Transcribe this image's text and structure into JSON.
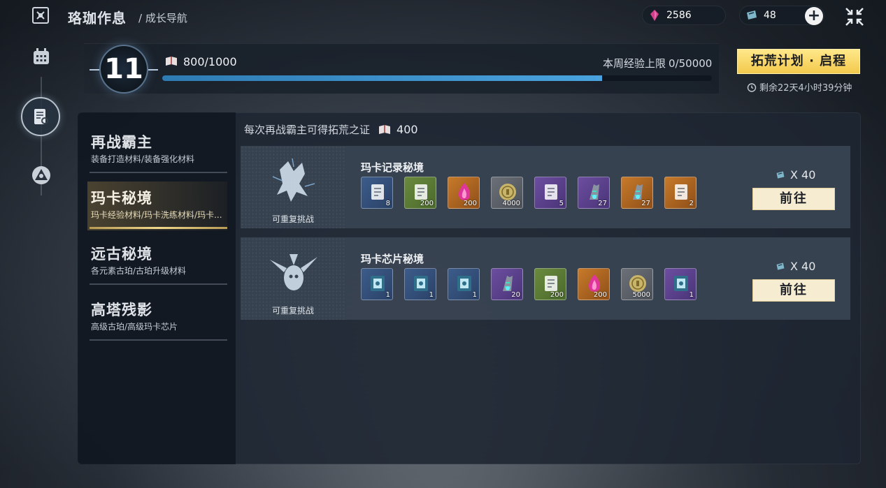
{
  "header": {
    "title": "珞珈作息",
    "subtitle": "/ 成长导航",
    "back_icon": "hex-frame-icon"
  },
  "currencies": [
    {
      "name": "crystal",
      "icon": "crystal-icon",
      "value": "2586"
    },
    {
      "name": "ticket",
      "icon": "ticket-icon",
      "value": "48"
    }
  ],
  "level": {
    "value": "11",
    "exp": "800/1000",
    "exp_fraction": 0.8,
    "weekly_label": "本周经验上限",
    "weekly_value": "0/50000"
  },
  "plan": {
    "button": "拓荒计划 · 启程",
    "countdown": "剩余22天4小时39分钟"
  },
  "sidebar": {
    "items": [
      {
        "name": "再战霸主",
        "desc": "装备打造材料/装备强化材料"
      },
      {
        "name": "玛卡秘境",
        "desc": "玛卡经验材料/玛卡洗练材料/玛卡..."
      },
      {
        "name": "远古秘境",
        "desc": "各元素古珀/古珀升级材料"
      },
      {
        "name": "高塔残影",
        "desc": "高级古珀/高级玛卡芯片"
      }
    ],
    "active_index": 1
  },
  "info": {
    "text": "每次再战霸主可得拓荒之证",
    "amount": "400"
  },
  "stages": [
    {
      "name": "玛卡记录秘境",
      "repeat": "可重复挑战",
      "cost": "X 40",
      "go": "前往",
      "items": [
        {
          "rarity": "blue",
          "icon": "book-icon",
          "qty": "8"
        },
        {
          "rarity": "green",
          "icon": "book-icon",
          "qty": "200"
        },
        {
          "rarity": "orange",
          "icon": "flame-crystal-icon",
          "qty": "200"
        },
        {
          "rarity": "gray",
          "icon": "coin-icon",
          "qty": "4000"
        },
        {
          "rarity": "purple",
          "icon": "book-icon",
          "qty": "5"
        },
        {
          "rarity": "purple",
          "icon": "claw-icon",
          "qty": "27"
        },
        {
          "rarity": "orange",
          "icon": "claw-icon",
          "qty": "27"
        },
        {
          "rarity": "orange",
          "icon": "book-icon",
          "qty": "2"
        }
      ]
    },
    {
      "name": "玛卡芯片秘境",
      "repeat": "可重复挑战",
      "cost": "X 40",
      "go": "前往",
      "items": [
        {
          "rarity": "blue",
          "icon": "chip-icon",
          "qty": "1"
        },
        {
          "rarity": "blue",
          "icon": "chip-icon",
          "qty": "1"
        },
        {
          "rarity": "blue",
          "icon": "chip-icon",
          "qty": "1"
        },
        {
          "rarity": "purple",
          "icon": "claw-icon",
          "qty": "20"
        },
        {
          "rarity": "green",
          "icon": "book-icon",
          "qty": "200"
        },
        {
          "rarity": "orange",
          "icon": "flame-crystal-icon",
          "qty": "200"
        },
        {
          "rarity": "gray",
          "icon": "coin-icon",
          "qty": "5000"
        },
        {
          "rarity": "purple",
          "icon": "chip-icon",
          "qty": "1"
        }
      ]
    }
  ],
  "colors": {
    "accent_gold": "#f2c94c",
    "progress_blue": "#4aa3de",
    "go_button": "#f5ecd2"
  }
}
